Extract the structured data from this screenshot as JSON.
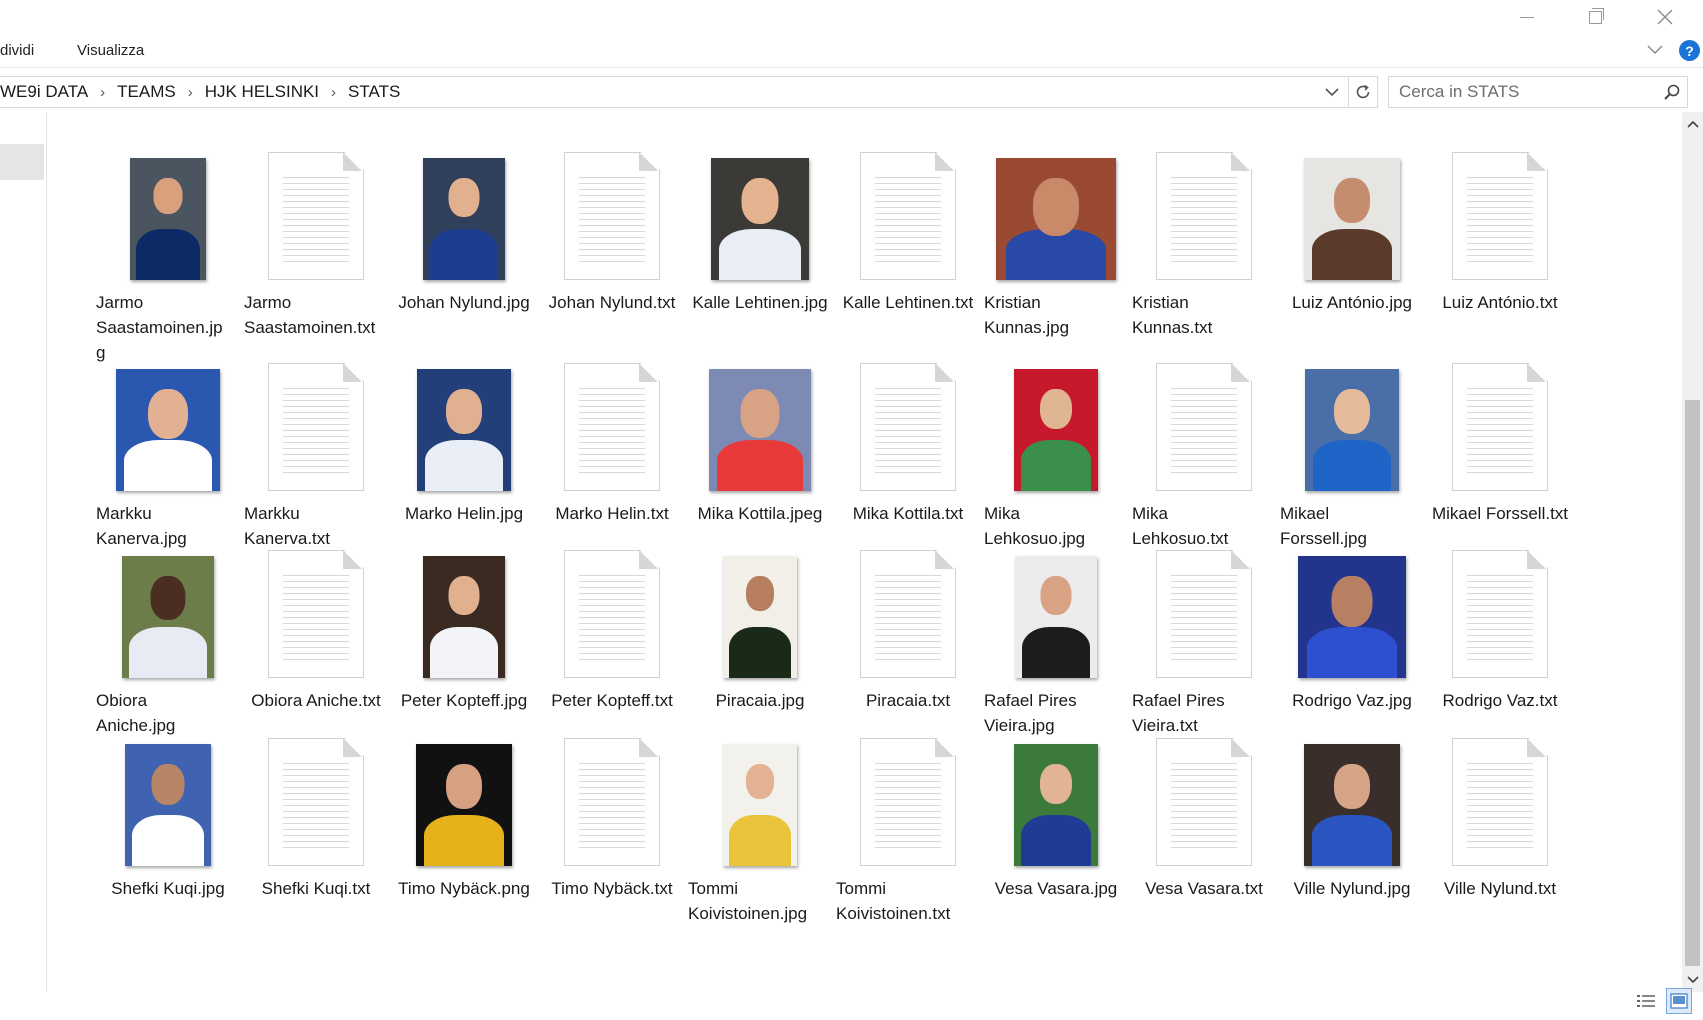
{
  "window": {
    "minimize_icon": "minimize-icon",
    "maximize_icon": "restore-icon",
    "close_icon": "close-icon"
  },
  "ribbon": {
    "tabs": [
      "dividi",
      "Visualizza"
    ],
    "help": "?"
  },
  "address": {
    "crumbs": [
      "WE9i DATA",
      "TEAMS",
      "HJK HELSINKI",
      "STATS"
    ],
    "separator": "›"
  },
  "search": {
    "placeholder": "Cerca in STATS"
  },
  "files": [
    {
      "name": "Jarmo Saastamoinen.jpg",
      "lines": [
        "Jarmo",
        "Saastamoinen.jp",
        "g"
      ],
      "type": "photo",
      "bg": "#4a5560",
      "kit": "#0d2a66",
      "skin": "#d9a07d"
    },
    {
      "name": "Jarmo Saastamoinen.txt",
      "lines": [
        "Jarmo",
        "Saastamoinen.txt"
      ],
      "type": "doc"
    },
    {
      "name": "Johan Nylund.jpg",
      "lines": [
        "Johan Nylund.jpg"
      ],
      "type": "photo",
      "bg": "#30405a",
      "kit": "#1b3c8f",
      "skin": "#e0b08f"
    },
    {
      "name": "Johan Nylund.txt",
      "lines": [
        "Johan Nylund.txt"
      ],
      "type": "doc"
    },
    {
      "name": "Kalle Lehtinen.jpg",
      "lines": [
        "Kalle Lehtinen.jpg"
      ],
      "type": "photo",
      "bg": "#3b3a36",
      "kit": "#e9edf5",
      "skin": "#e5b390"
    },
    {
      "name": "Kalle Lehtinen.txt",
      "lines": [
        "Kalle Lehtinen.txt"
      ],
      "type": "doc"
    },
    {
      "name": "Kristian Kunnas.jpg",
      "lines": [
        "Kristian",
        "Kunnas.jpg"
      ],
      "type": "photo",
      "bg": "#9a4a33",
      "kit": "#2849a8",
      "skin": "#c98a6a"
    },
    {
      "name": "Kristian Kunnas.txt",
      "lines": [
        "Kristian",
        "Kunnas.txt"
      ],
      "type": "doc"
    },
    {
      "name": "Luiz António.jpg",
      "lines": [
        "Luiz António.jpg"
      ],
      "type": "photo",
      "bg": "#e7e5e2",
      "kit": "#5a3a2a",
      "skin": "#c48d6e"
    },
    {
      "name": "Luiz António.txt",
      "lines": [
        "Luiz António.txt"
      ],
      "type": "doc"
    },
    {
      "name": "Markku Kanerva.jpg",
      "lines": [
        "Markku",
        "Kanerva.jpg"
      ],
      "type": "photo",
      "bg": "#2a57b0",
      "kit": "#ffffff",
      "skin": "#e2b092"
    },
    {
      "name": "Markku Kanerva.txt",
      "lines": [
        "Markku",
        "Kanerva.txt"
      ],
      "type": "doc"
    },
    {
      "name": "Marko Helin.jpg",
      "lines": [
        "Marko Helin.jpg"
      ],
      "type": "photo",
      "bg": "#233f7a",
      "kit": "#e9eef7",
      "skin": "#e1b091"
    },
    {
      "name": "Marko Helin.txt",
      "lines": [
        "Marko Helin.txt"
      ],
      "type": "doc"
    },
    {
      "name": "Mika Kottila.jpeg",
      "lines": [
        "Mika Kottila.jpeg"
      ],
      "type": "photo",
      "bg": "#7d8bb4",
      "kit": "#e83a3a",
      "skin": "#d8a385"
    },
    {
      "name": "Mika Kottila.txt",
      "lines": [
        "Mika Kottila.txt"
      ],
      "type": "doc"
    },
    {
      "name": "Mika Lehkosuo.jpg",
      "lines": [
        "Mika",
        "Lehkosuo.jpg"
      ],
      "type": "photo",
      "bg": "#c8182b",
      "kit": "#3a8f4a",
      "skin": "#e0b592"
    },
    {
      "name": "Mika Lehkosuo.txt",
      "lines": [
        "Mika",
        "Lehkosuo.txt"
      ],
      "type": "doc"
    },
    {
      "name": "Mikael Forssell.jpg",
      "lines": [
        "Mikael",
        "Forssell.jpg"
      ],
      "type": "photo",
      "bg": "#4a6fa8",
      "kit": "#1f65c8",
      "skin": "#e6bb9b"
    },
    {
      "name": "Mikael Forssell.txt",
      "lines": [
        "Mikael Forssell.txt"
      ],
      "type": "doc"
    },
    {
      "name": "Obiora Aniche.jpg",
      "lines": [
        "Obiora",
        "Aniche.jpg"
      ],
      "type": "photo",
      "bg": "#6d7d4a",
      "kit": "#e8ebf3",
      "skin": "#4a2e22"
    },
    {
      "name": "Obiora Aniche.txt",
      "lines": [
        "Obiora Aniche.txt"
      ],
      "type": "doc"
    },
    {
      "name": "Peter Kopteff.jpg",
      "lines": [
        "Peter Kopteff.jpg"
      ],
      "type": "photo",
      "bg": "#3a2a22",
      "kit": "#f3f4f8",
      "skin": "#e0b08f"
    },
    {
      "name": "Peter Kopteff.txt",
      "lines": [
        "Peter Kopteff.txt"
      ],
      "type": "doc"
    },
    {
      "name": "Piracaia.jpg",
      "lines": [
        "Piracaia.jpg"
      ],
      "type": "photo",
      "bg": "#f2efe8",
      "kit": "#1a2a18",
      "skin": "#b67e5e"
    },
    {
      "name": "Piracaia.txt",
      "lines": [
        "Piracaia.txt"
      ],
      "type": "doc"
    },
    {
      "name": "Rafael Pires Vieira.jpg",
      "lines": [
        "Rafael Pires",
        "Vieira.jpg"
      ],
      "type": "photo",
      "bg": "#ececec",
      "kit": "#1d1d1d",
      "skin": "#d8a285"
    },
    {
      "name": "Rafael Pires Vieira.txt",
      "lines": [
        "Rafael Pires",
        "Vieira.txt"
      ],
      "type": "doc"
    },
    {
      "name": "Rodrigo Vaz.jpg",
      "lines": [
        "Rodrigo Vaz.jpg"
      ],
      "type": "photo",
      "bg": "#23348c",
      "kit": "#2d4fd0",
      "skin": "#b88062"
    },
    {
      "name": "Rodrigo Vaz.txt",
      "lines": [
        "Rodrigo Vaz.txt"
      ],
      "type": "doc"
    },
    {
      "name": "Shefki Kuqi.jpg",
      "lines": [
        "Shefki Kuqi.jpg"
      ],
      "type": "photo",
      "bg": "#3f63b0",
      "kit": "#ffffff",
      "skin": "#b88466"
    },
    {
      "name": "Shefki Kuqi.txt",
      "lines": [
        "Shefki Kuqi.txt"
      ],
      "type": "doc"
    },
    {
      "name": "Timo Nybäck.png",
      "lines": [
        "Timo Nybäck.png"
      ],
      "type": "photo",
      "bg": "#111111",
      "kit": "#e6b21c",
      "skin": "#d6a081"
    },
    {
      "name": "Timo Nybäck.txt",
      "lines": [
        "Timo Nybäck.txt"
      ],
      "type": "doc"
    },
    {
      "name": "Tommi Koivistoinen.jpg",
      "lines": [
        "Tommi",
        "Koivistoinen.jpg"
      ],
      "type": "photo",
      "bg": "#f3f1ec",
      "kit": "#e9c43a",
      "skin": "#e2b293"
    },
    {
      "name": "Tommi Koivistoinen.txt",
      "lines": [
        "Tommi",
        "Koivistoinen.txt"
      ],
      "type": "doc"
    },
    {
      "name": "Vesa Vasara.jpg",
      "lines": [
        "Vesa Vasara.jpg"
      ],
      "type": "photo",
      "bg": "#3b7a3a",
      "kit": "#1e3c94",
      "skin": "#e0b494"
    },
    {
      "name": "Vesa Vasara.txt",
      "lines": [
        "Vesa Vasara.txt"
      ],
      "type": "doc"
    },
    {
      "name": "Ville Nylund.jpg",
      "lines": [
        "Ville Nylund.jpg"
      ],
      "type": "photo",
      "bg": "#3a2e2a",
      "kit": "#2b55c0",
      "skin": "#d6a487"
    },
    {
      "name": "Ville Nylund.txt",
      "lines": [
        "Ville Nylund.txt"
      ],
      "type": "doc"
    }
  ],
  "colors": {
    "accent": "#1a73d6",
    "selection": "#dbe9f8",
    "nav_selected": "#e5e5e5"
  }
}
